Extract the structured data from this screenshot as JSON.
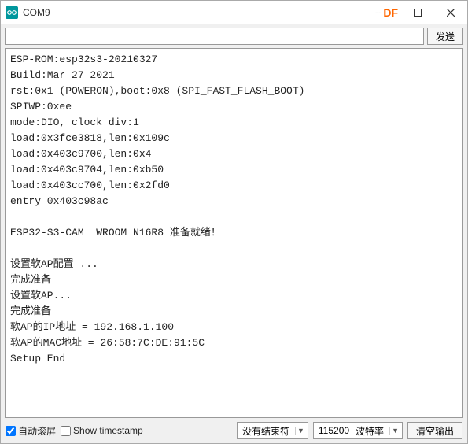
{
  "titlebar": {
    "title": "COM9",
    "df_badge": "DF",
    "dashes": "--"
  },
  "input_row": {
    "value": "",
    "placeholder": "",
    "send_label": "发送"
  },
  "console_lines": [
    "ESP-ROM:esp32s3-20210327",
    "Build:Mar 27 2021",
    "rst:0x1 (POWERON),boot:0x8 (SPI_FAST_FLASH_BOOT)",
    "SPIWP:0xee",
    "mode:DIO, clock div:1",
    "load:0x3fce3818,len:0x109c",
    "load:0x403c9700,len:0x4",
    "load:0x403c9704,len:0xb50",
    "load:0x403cc700,len:0x2fd0",
    "entry 0x403c98ac",
    "",
    "ESP32-S3-CAM  WROOM N16R8 准备就绪！",
    "",
    "设置软AP配置 ...",
    "完成准备",
    "设置软AP...",
    "完成准备",
    "软AP的IP地址 = 192.168.1.100",
    "软AP的MAC地址 = 26:58:7C:DE:91:5C",
    "Setup End"
  ],
  "bottom": {
    "autoscroll_label": "自动滚屏",
    "autoscroll_checked": true,
    "timestamp_label": "Show timestamp",
    "timestamp_checked": false,
    "line_ending": "没有结束符",
    "baud_value": "115200",
    "baud_label": "波特率",
    "clear_label": "清空输出"
  }
}
